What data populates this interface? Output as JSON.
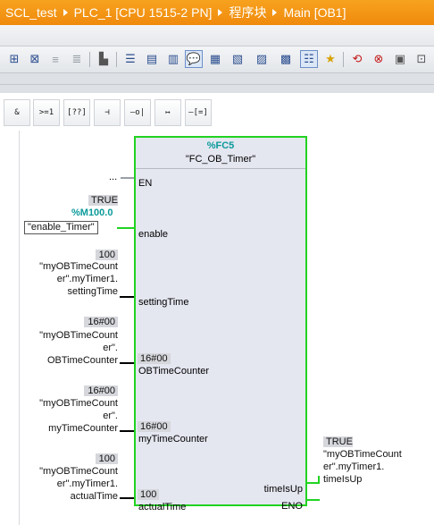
{
  "breadcrumb": {
    "items": [
      "SCL_test",
      "PLC_1 [CPU 1515-2 PN]",
      "程序块",
      "Main [OB1]"
    ]
  },
  "toolbar": {
    "icons": [
      "insert-network-icon",
      "delete-network-icon",
      "insert-row-icon",
      "add-row-icon",
      "eraser-icon",
      "open-all-networks-icon",
      "close-all-networks-icon",
      "network-comments-icon",
      "show-comments-icon",
      "absolute-operands-icon",
      "favorites-icon",
      "monitor-icon",
      "breakpoint-icon",
      "call-hierarchy-icon",
      "goto-icon",
      "delete-breakpoint-icon",
      "toggle-icon"
    ]
  },
  "instructions": {
    "and_label": "&",
    "ge1_label": ">=1",
    "box_label": "[??]",
    "contact_label": "⊣",
    "neg_contact_label": "–o|",
    "branch_label": "↦",
    "assign_label": "–[=]"
  },
  "block": {
    "name": "%FC5",
    "type": "\"FC_OB_Timer\"",
    "pins_in": {
      "en": "EN",
      "enable": "enable",
      "settingTime": "settingTime",
      "OBTimeCounter": "OBTimeCounter",
      "myTimeCounter": "myTimeCounter",
      "actualTime": "actualTime"
    },
    "pins_out": {
      "timeIsUp": "timeIsUp",
      "eno": "ENO"
    },
    "inner_values": {
      "OBTimeCounter": "16#00",
      "myTimeCounter": "16#00",
      "actualTime": "100"
    }
  },
  "operands": {
    "en": "...",
    "enable": {
      "value": "TRUE",
      "address": "%M100.0",
      "symbol": "\"enable_Timer\""
    },
    "settingTime": {
      "value": "100",
      "lines": [
        "\"myOBTimeCount",
        "er\".myTimer1.",
        "settingTime"
      ]
    },
    "OBTimeCounter": {
      "value": "16#00",
      "lines": [
        "\"myOBTimeCount",
        "er\".",
        "OBTimeCounter"
      ]
    },
    "myTimeCounter": {
      "value": "16#00",
      "lines": [
        "\"myOBTimeCount",
        "er\".",
        "myTimeCounter"
      ]
    },
    "actualTime": {
      "value": "100",
      "lines": [
        "\"myOBTimeCount",
        "er\".myTimer1.",
        "actualTime"
      ]
    },
    "timeIsUp": {
      "value": "TRUE",
      "lines": [
        "\"myOBTimeCount",
        "er\".myTimer1.",
        "timeIsUp"
      ]
    }
  },
  "colors": {
    "title_bar": "#f08a0c",
    "block_border": "#21d321",
    "block_bg": "#e4e6f0",
    "operand_green": "#0a9a9a"
  }
}
